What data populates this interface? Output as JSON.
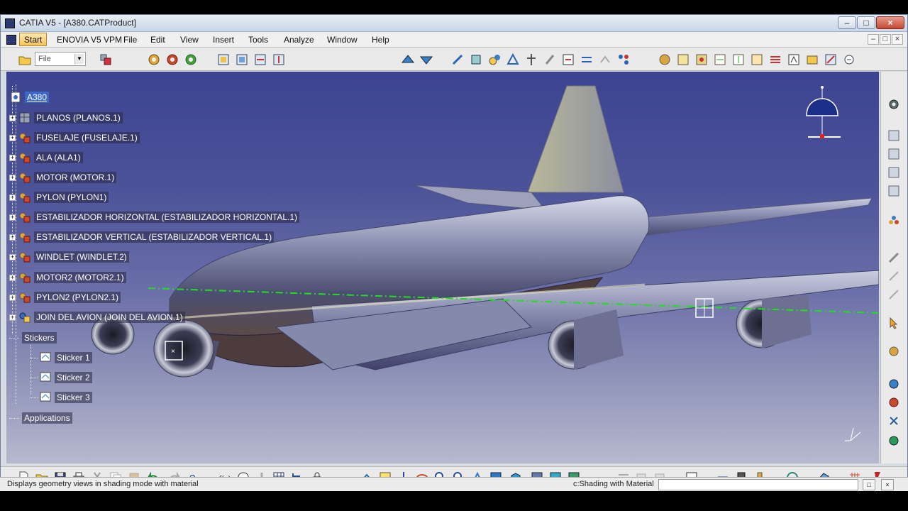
{
  "window": {
    "title": "CATIA V5 - [A380.CATProduct]",
    "controls": {
      "minimize": "–",
      "maximize": "□",
      "close": "×"
    }
  },
  "menubar": {
    "items": [
      "Start",
      "ENOVIA V5 VPM",
      "File",
      "Edit",
      "View",
      "Insert",
      "Tools",
      "Analyze",
      "Window",
      "Help"
    ],
    "doc_controls": {
      "minimize": "–",
      "restore": "□",
      "close": "×"
    }
  },
  "toolbar": {
    "file_combo_value": "File"
  },
  "tree": {
    "root": "A380",
    "items": [
      "PLANOS (PLANOS.1)",
      "FUSELAJE (FUSELAJE.1)",
      "ALA (ALA1)",
      "MOTOR (MOTOR.1)",
      "PYLON (PYLON1)",
      "ESTABILIZADOR HORIZONTAL (ESTABILIZADOR HORIZONTAL.1)",
      "ESTABILIZADOR VERTICAL (ESTABILIZADOR VERTICAL.1)",
      "WINDLET (WINDLET.2)",
      "MOTOR2 (MOTOR2.1)",
      "PYLON2 (PYLON2.1)",
      "JOIN DEL AVION (JOIN DEL AVION.1)"
    ],
    "stickers_label": "Stickers",
    "stickers": [
      "Sticker 1",
      "Sticker 2",
      "Sticker 3"
    ],
    "applications_label": "Applications"
  },
  "statusbar": {
    "message": "Displays geometry views in shading mode with material",
    "command": "c:Shading with Material",
    "input_value": ""
  },
  "colors": {
    "viewport_top": "#3c4391",
    "viewport_bottom": "#b6b9ce",
    "axis_line": "#22dd22",
    "selection": "#3a68c7"
  },
  "icons": {
    "top_toolbar": [
      "open-folder-icon",
      "product-icon",
      "gear-icon",
      "gear-icon",
      "gear-icon",
      "assembly-icon",
      "assembly-icon",
      "assembly-icon",
      "assembly-icon",
      "fly-icon",
      "fly-icon",
      "constraint-icon",
      "constraint-icon",
      "constraint-icon",
      "constraint-icon",
      "constraint-icon",
      "constraint-icon",
      "constraint-icon",
      "constraint-icon",
      "constraint-icon",
      "constraint-icon",
      "analysis-icon",
      "analysis-icon",
      "analysis-icon",
      "analysis-icon",
      "analysis-icon",
      "analysis-icon",
      "analysis-icon",
      "analysis-icon",
      "analysis-icon",
      "analysis-icon",
      "analysis-icon"
    ],
    "bottom_toolbar": [
      "new-icon",
      "open-icon",
      "save-icon",
      "print-icon",
      "cut-icon",
      "copy-icon",
      "paste-icon",
      "undo-icon",
      "redo-icon",
      "whats-this-icon",
      "formula-icon",
      "comment-icon",
      "knowledge-icon",
      "table-icon",
      "tree-icon",
      "lock-icon",
      "measure-icon",
      "fly-mode-icon",
      "fit-all-icon",
      "pan-icon",
      "rotate-icon",
      "zoom-in-icon",
      "zoom-out-icon",
      "normal-view-icon",
      "multi-view-icon",
      "iso-view-icon",
      "shading-icon",
      "material-icon",
      "material-view-icon",
      "hide-show-icon",
      "swap-icon",
      "layer-icon",
      "filter-icon",
      "catalog-icon",
      "scene-icon",
      "compass-icon",
      "sticker-icon",
      "grid-icon",
      "catia-logo-icon"
    ]
  }
}
